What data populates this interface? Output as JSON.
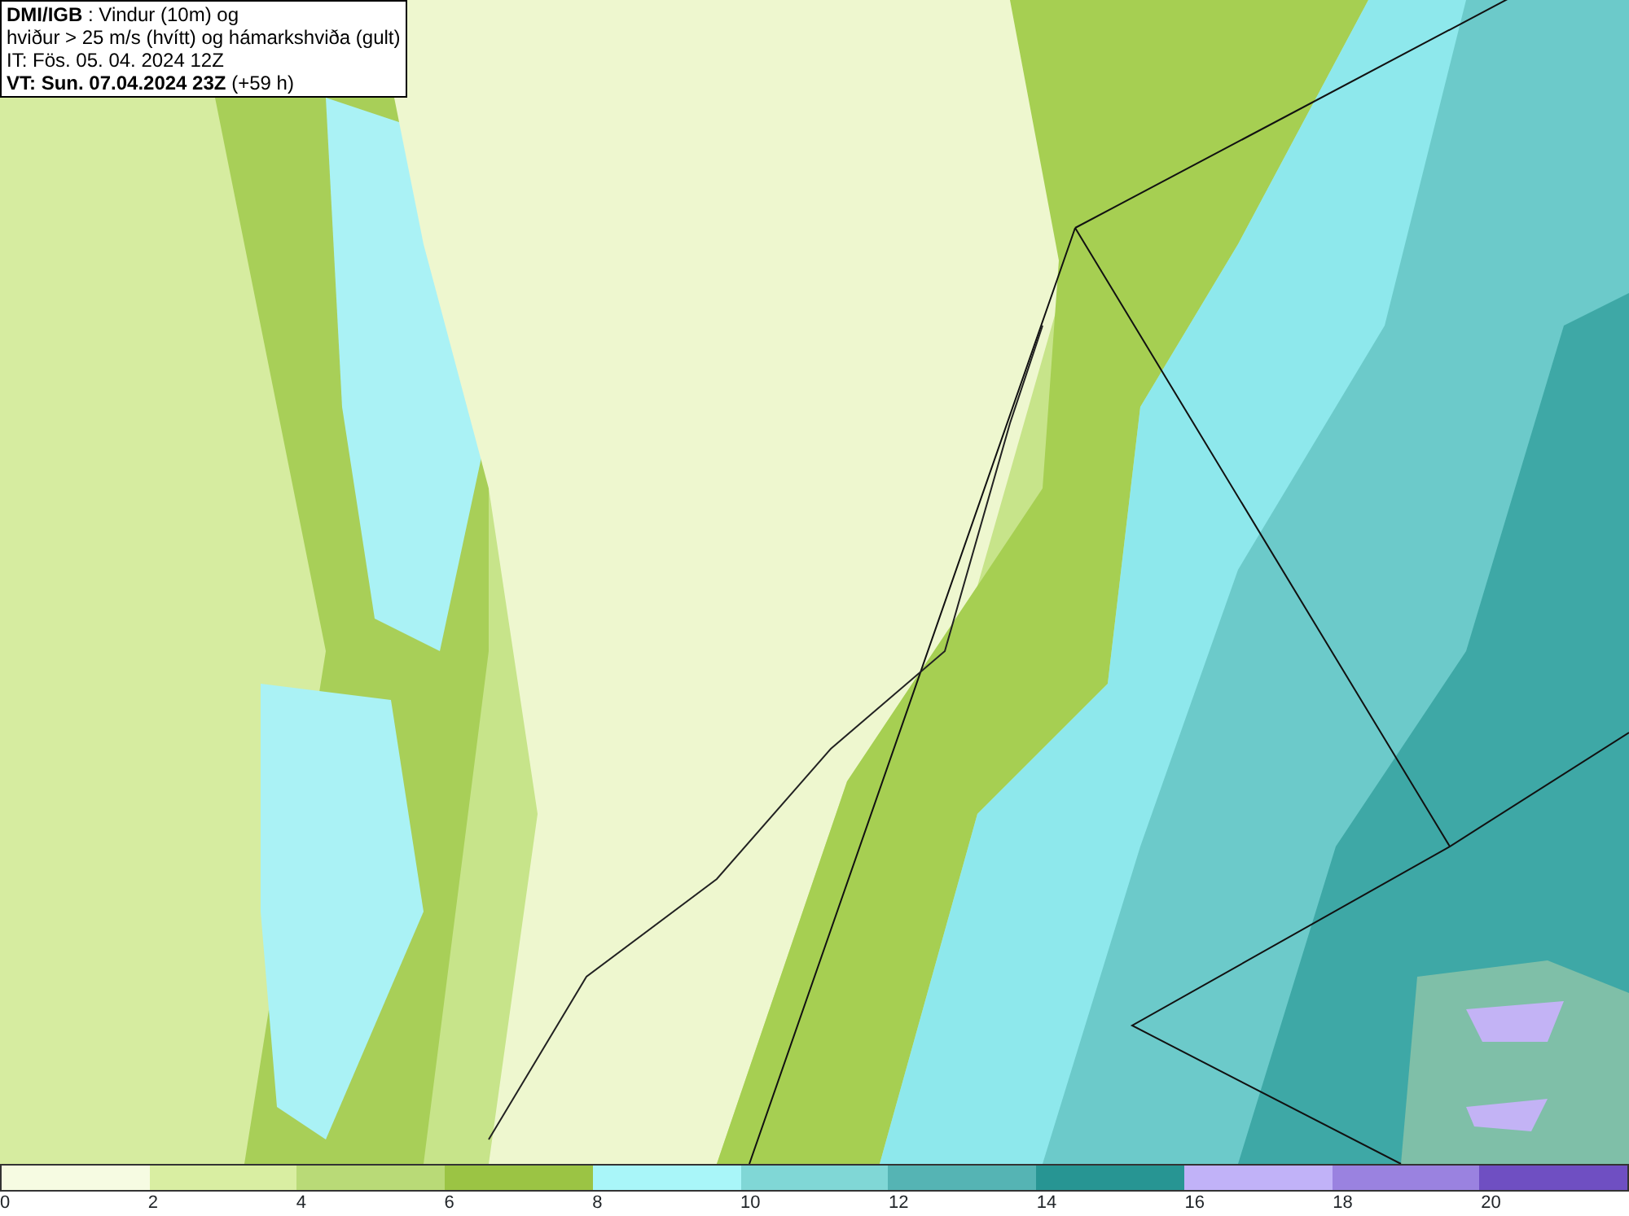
{
  "title_box": {
    "lines": [
      "**DMI/IGB** : Vindur (10m) og",
      "hviður > 25 m/s (hvítt) og hámarkshviða (gult)",
      "IT: Fös. 05. 04. 2024 12Z",
      "**VT: Sun. 07.04.2024 23Z** (+59 h)"
    ]
  },
  "colorbar": {
    "segments": [
      {
        "color": "#f6fbe2"
      },
      {
        "color": "#d9eea2"
      },
      {
        "color": "#b9da77"
      },
      {
        "color": "#9bc444"
      },
      {
        "color": "#a9f6f9"
      },
      {
        "color": "#80d7d6"
      },
      {
        "color": "#55b4b4"
      },
      {
        "color": "#279593"
      },
      {
        "color": "#c1b2f8"
      },
      {
        "color": "#9a82e0"
      },
      {
        "color": "#6f4fc2"
      }
    ],
    "ticks": [
      "0",
      "2",
      "4",
      "6",
      "8",
      "10",
      "12",
      "14",
      "16",
      "18",
      "20"
    ]
  }
}
